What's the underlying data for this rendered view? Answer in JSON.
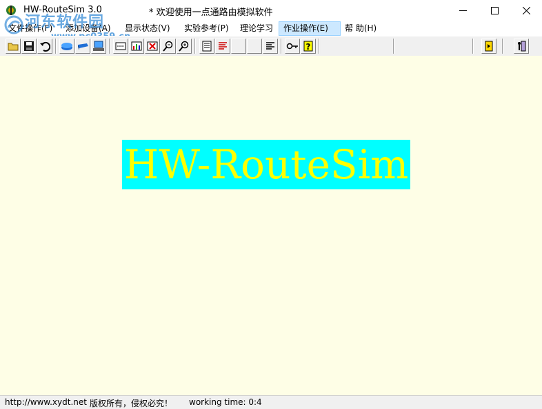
{
  "titlebar": {
    "app_title": "HW-RouteSim 3.0",
    "subtitle": "* 欢迎使用一点通路由模拟软件",
    "watermark_text": "河东软件园",
    "watermark_url": "www.pc0359.cn"
  },
  "menu": {
    "items": [
      {
        "label": "文件操作(F)"
      },
      {
        "label": "添加设备(A)"
      },
      {
        "label": "显示状态(V)"
      },
      {
        "label": "实验参考(P)"
      },
      {
        "label": "理论学习"
      },
      {
        "label": "作业操作(E)"
      },
      {
        "label": "帮  助(H)"
      }
    ]
  },
  "toolbar": {
    "buttons": [
      "open-folder-icon",
      "save-icon",
      "undo-icon",
      "router-icon",
      "switch-icon",
      "pc-icon",
      "connect-icon",
      "chart-icon",
      "delete-icon",
      "zoom-out-icon",
      "zoom-in-icon",
      "document-icon",
      "text-lines-icon",
      "blank-icon",
      "blank-icon",
      "align-icon",
      "key-icon",
      "help-icon",
      "exit-door-icon",
      "exit-person-icon"
    ]
  },
  "splash": {
    "text": "HW-RouteSim"
  },
  "statusbar": {
    "url": "http://www.xydt.net",
    "copyright": "版权所有，侵权必究！",
    "working_time": "working time: 0:4"
  },
  "colors": {
    "canvas_bg": "#fefee6",
    "splash_bg": "#00ffff",
    "splash_text": "#ffff00",
    "watermark": "#3a8ed8"
  }
}
